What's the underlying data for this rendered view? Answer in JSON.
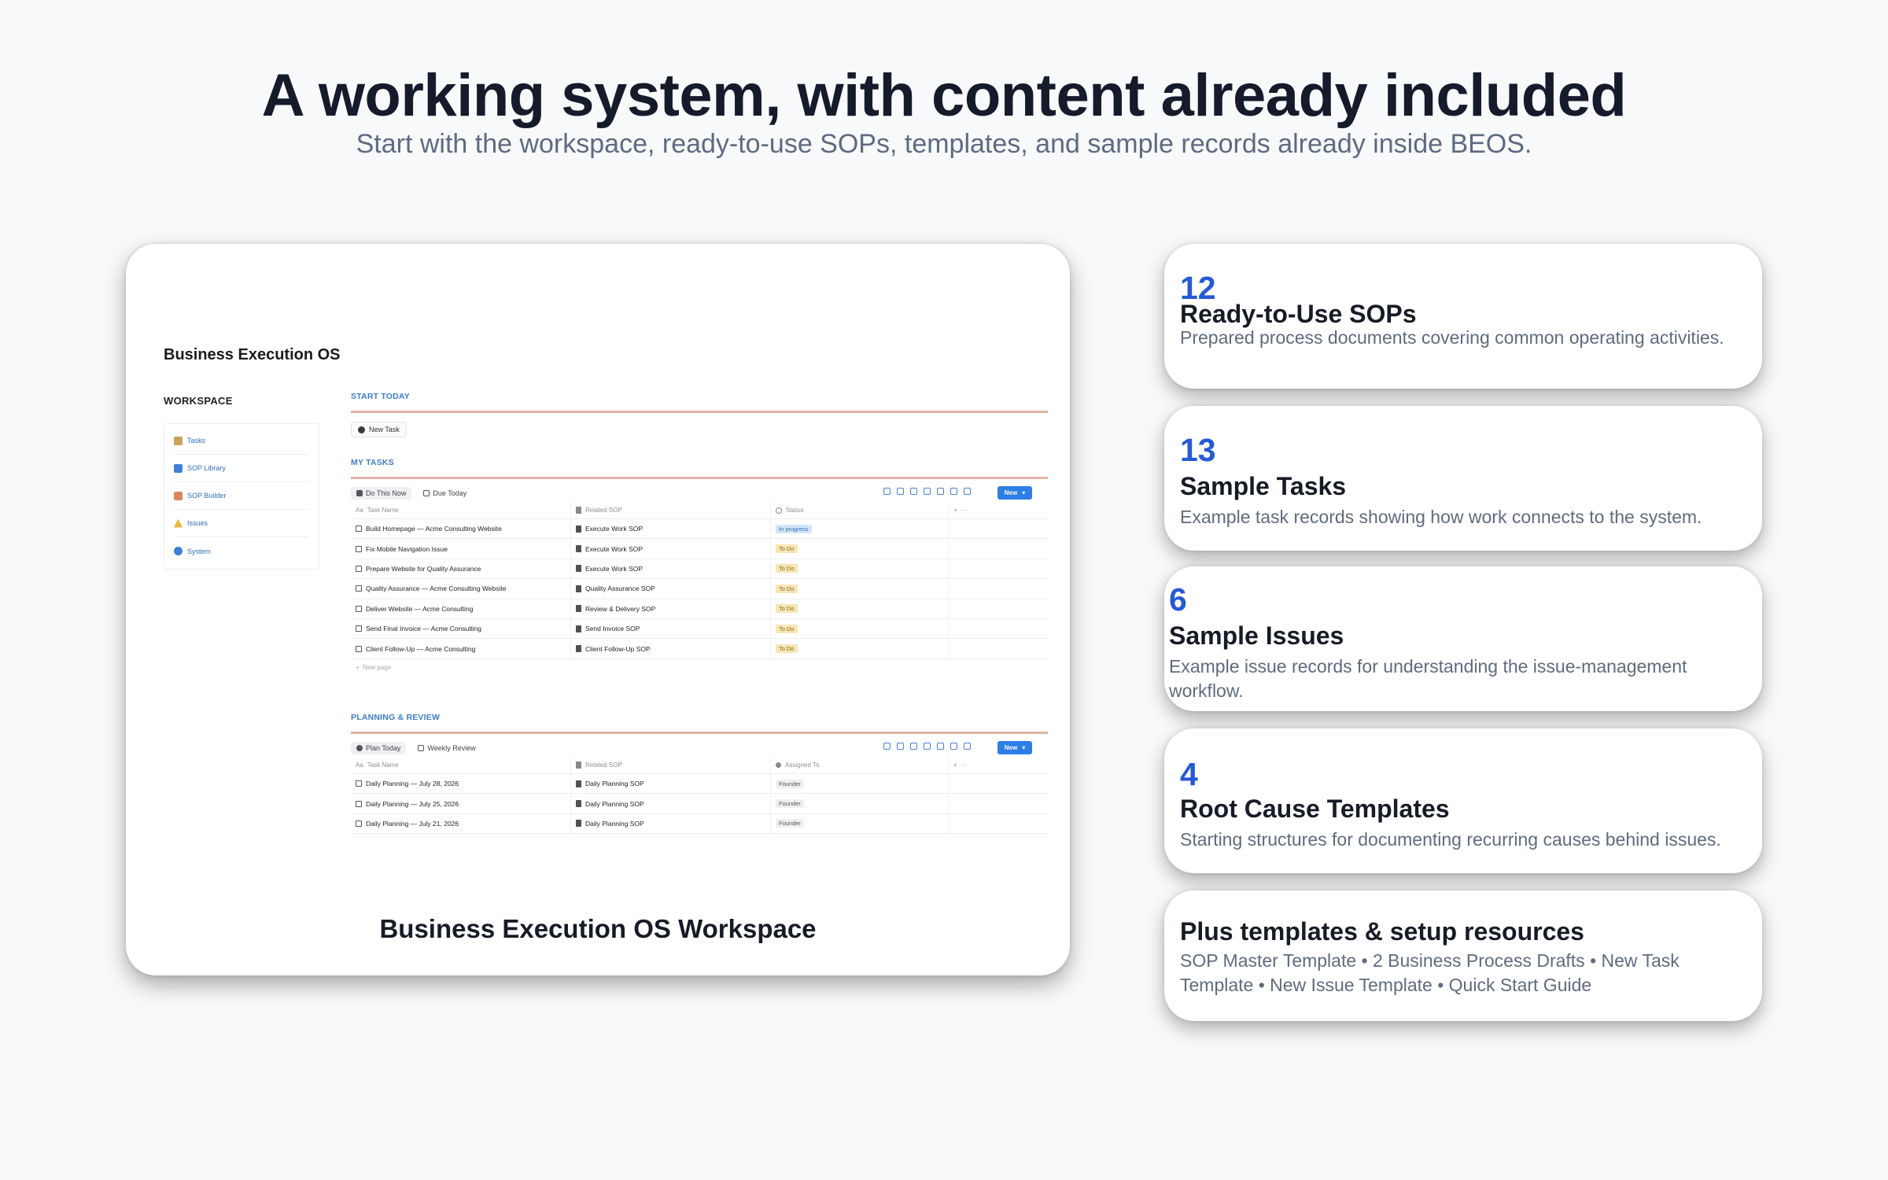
{
  "hero": {
    "title": "A working system, with content already included",
    "subtitle": "Start with the workspace, ready-to-use SOPs, templates, and sample records already inside BEOS."
  },
  "preview": {
    "caption": "Business Execution OS Workspace",
    "workspace_title": "Business Execution OS",
    "workspace_label": "WORKSPACE",
    "nav": [
      {
        "label": "Tasks",
        "icon": "pencil-note-icon",
        "color": "#c9a35a"
      },
      {
        "label": "SOP Library",
        "icon": "book-icon",
        "color": "#3f7fd6"
      },
      {
        "label": "SOP Builder",
        "icon": "builder-icon",
        "color": "#d88a5c"
      },
      {
        "label": "Issues",
        "icon": "warning-icon",
        "color": "#e6b93c"
      },
      {
        "label": "System",
        "icon": "gear-icon",
        "color": "#3f7fd6"
      }
    ],
    "start_today": {
      "heading": "START TODAY",
      "new_task": "New Task"
    },
    "my_tasks": {
      "heading": "MY TASKS",
      "views": [
        "Do This Now",
        "Due Today"
      ],
      "new_label": "New",
      "columns": [
        "Task Name",
        "Related SOP",
        "Status"
      ],
      "rows": [
        {
          "task": "Build Homepage — Acme Consulting Website",
          "sop": "Execute Work SOP",
          "status": "In progress",
          "kind": "prog"
        },
        {
          "task": "Fix Mobile Navigation Issue",
          "sop": "Execute Work SOP",
          "status": "To Do",
          "kind": "todo"
        },
        {
          "task": "Prepare Website for Quality Assurance",
          "sop": "Execute Work SOP",
          "status": "To Do",
          "kind": "todo"
        },
        {
          "task": "Quality Assurance — Acme Consulting Website",
          "sop": "Quality Assurance SOP",
          "status": "To Do",
          "kind": "todo"
        },
        {
          "task": "Deliver Website — Acme Consulting",
          "sop": "Review & Delivery SOP",
          "status": "To Do",
          "kind": "todo"
        },
        {
          "task": "Send Final Invoice — Acme Consulting",
          "sop": "Send Invoice SOP",
          "status": "To Do",
          "kind": "todo"
        },
        {
          "task": "Client Follow-Up — Acme Consulting",
          "sop": "Client Follow-Up SOP",
          "status": "To Do",
          "kind": "todo"
        }
      ],
      "new_page": "New page"
    },
    "planning": {
      "heading": "PLANNING & REVIEW",
      "views": [
        "Plan Today",
        "Weekly Review"
      ],
      "new_label": "New",
      "columns": [
        "Task Name",
        "Related SOP",
        "Assigned To"
      ],
      "rows": [
        {
          "task": "Daily Planning — July 28, 2026",
          "sop": "Daily Planning SOP",
          "status": "Founder",
          "kind": "plain"
        },
        {
          "task": "Daily Planning — July 25, 2026",
          "sop": "Daily Planning SOP",
          "status": "Founder",
          "kind": "plain"
        },
        {
          "task": "Daily Planning — July 21, 2026",
          "sop": "Daily Planning SOP",
          "status": "Founder",
          "kind": "plain"
        }
      ]
    }
  },
  "stats": [
    {
      "number": "12",
      "title": "Ready-to-Use SOPs",
      "desc": "Prepared process documents covering common operating activities."
    },
    {
      "number": "13",
      "title": "Sample Tasks",
      "desc": "Example task records showing how work connects to the system."
    },
    {
      "number": "6",
      "title": "Sample Issues",
      "desc": "Example issue records for understanding the issue-management workflow."
    },
    {
      "number": "4",
      "title": "Root Cause Templates",
      "desc": "Starting structures for documenting recurring causes behind issues."
    },
    {
      "number": "",
      "title": "Plus templates & setup resources",
      "desc": "SOP Master Template • 2 Business Process Drafts • New Task Template • New Issue Template • Quick Start Guide"
    }
  ],
  "colors": {
    "accent": "#2659d4",
    "background": "#f8f9fb",
    "button_blue": "#2d7ee6"
  }
}
